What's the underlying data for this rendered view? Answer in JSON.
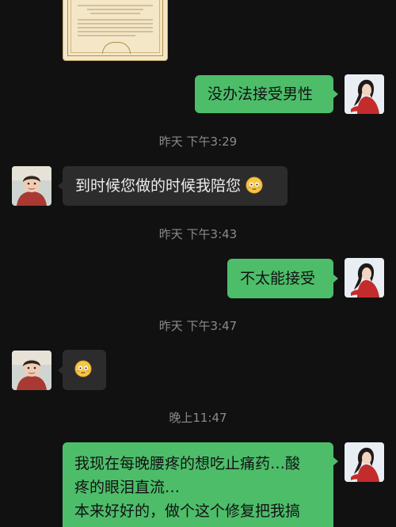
{
  "messages": {
    "msg1": {
      "text": "没办法接受男性"
    },
    "time1": {
      "text": "昨天 下午3:29"
    },
    "msg2": {
      "text": "到时候您做的时候我陪您",
      "emoji": "flushed-face-icon"
    },
    "time2": {
      "text": "昨天 下午3:43"
    },
    "msg3": {
      "text": "不太能接受"
    },
    "time3": {
      "text": "昨天 下午3:47"
    },
    "msg4": {
      "emoji": "flushed-face-icon"
    },
    "time4": {
      "text": "晚上11:47"
    },
    "msg5": {
      "lines": [
        "我现在每晚腰疼的想吃止痛药…酸",
        "疼的眼泪直流…",
        "本来好好的，做个这个修复把我搞"
      ]
    }
  },
  "colors": {
    "background": "#111111",
    "own_bubble": "#4dbd6a",
    "other_bubble": "#2c2c2c",
    "timestamp": "#8a8a8a"
  }
}
